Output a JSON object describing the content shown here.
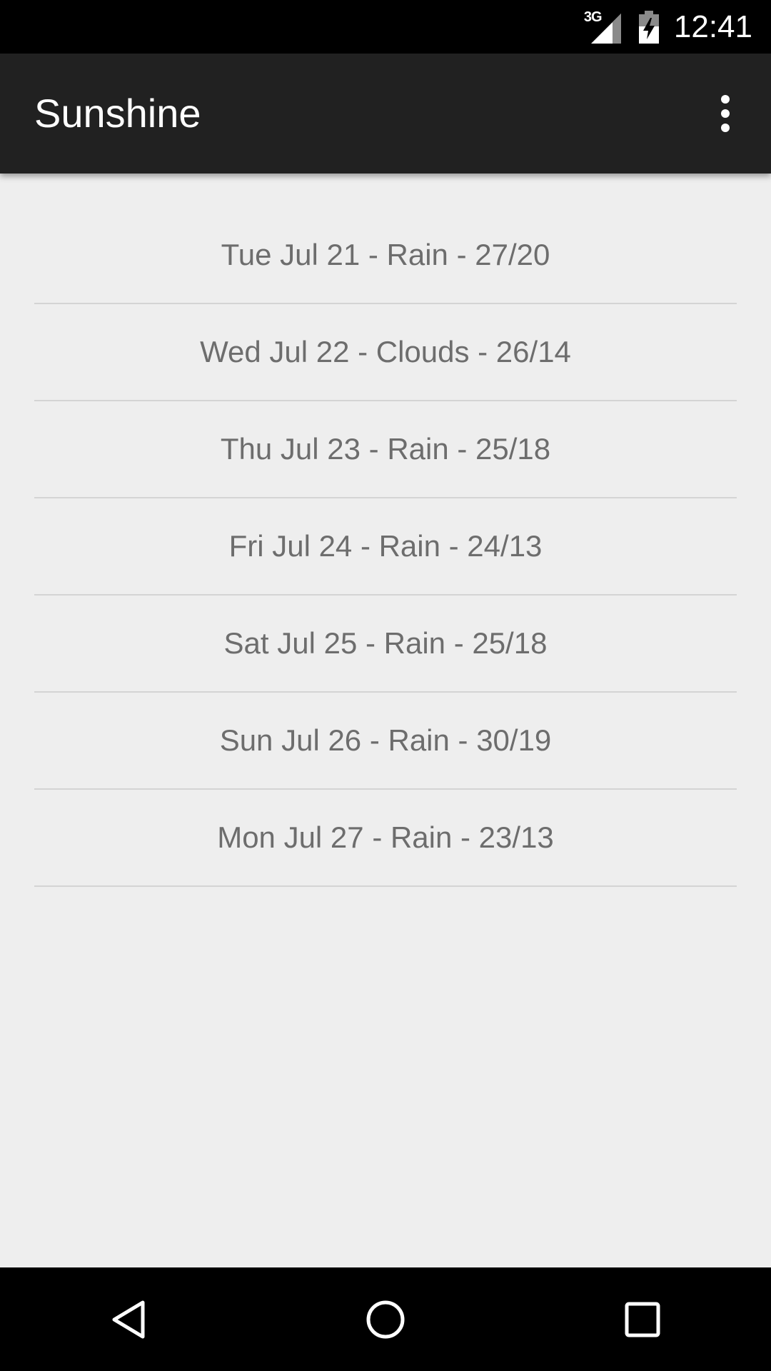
{
  "status_bar": {
    "network_label": "3G",
    "time": "12:41",
    "icons": [
      "signal-icon",
      "battery-charging-icon"
    ]
  },
  "app_bar": {
    "title": "Sunshine",
    "overflow_icon": "more-vert-icon"
  },
  "forecast": {
    "items": [
      {
        "text": "Tue Jul 21 - Rain - 27/20"
      },
      {
        "text": "Wed Jul 22 - Clouds - 26/14"
      },
      {
        "text": "Thu Jul 23 - Rain - 25/18"
      },
      {
        "text": "Fri Jul 24 - Rain - 24/13"
      },
      {
        "text": "Sat Jul 25 - Rain - 25/18"
      },
      {
        "text": "Sun Jul 26 - Rain - 30/19"
      },
      {
        "text": "Mon Jul 27 - Rain - 23/13"
      }
    ]
  },
  "nav_bar": {
    "icons": [
      "back-icon",
      "home-icon",
      "recents-icon"
    ]
  },
  "colors": {
    "status_bar": "#000000",
    "app_bar": "#212121",
    "background": "#eeeeee",
    "list_text": "#6d6d6d",
    "divider": "#d4d4d4"
  }
}
